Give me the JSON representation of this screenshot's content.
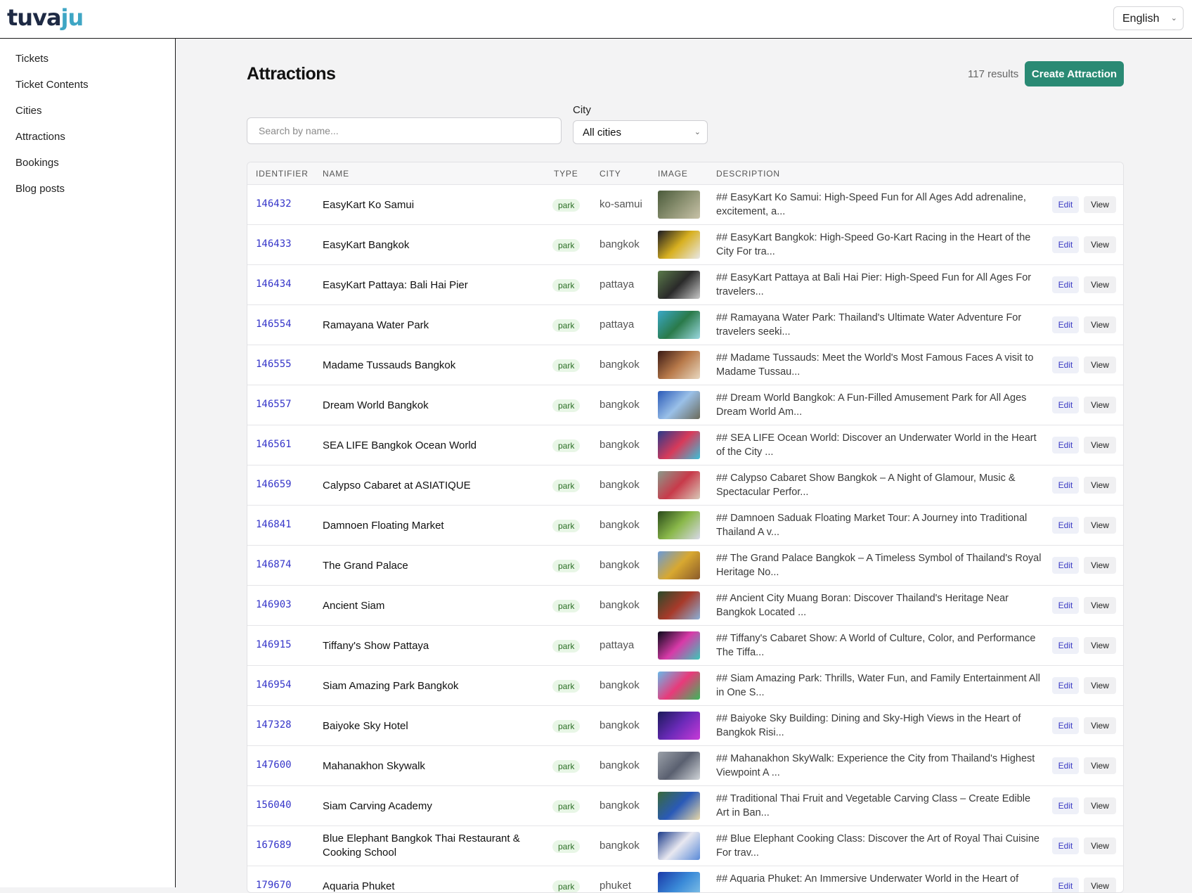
{
  "header": {
    "logo_main": "tuva",
    "logo_accent": "ju",
    "language": "English"
  },
  "sidebar": {
    "items": [
      {
        "label": "Tickets"
      },
      {
        "label": "Ticket Contents"
      },
      {
        "label": "Cities"
      },
      {
        "label": "Attractions"
      },
      {
        "label": "Bookings"
      },
      {
        "label": "Blog posts"
      }
    ]
  },
  "page": {
    "title": "Attractions",
    "results": "117 results",
    "create_label": "Create Attraction",
    "search_placeholder": "Search by name...",
    "city_label": "City",
    "city_value": "All cities"
  },
  "table": {
    "columns": [
      "IDENTIFIER",
      "NAME",
      "TYPE",
      "CITY",
      "IMAGE",
      "DESCRIPTION"
    ],
    "edit_label": "Edit",
    "view_label": "View",
    "rows": [
      {
        "id": "146432",
        "name": "EasyKart Ko Samui",
        "type": "park",
        "city": "ko-samui",
        "desc": "## EasyKart Ko Samui: High-Speed Fun for All Ages Add adrenaline, excitement, a...",
        "colors": [
          "#4a5a3a",
          "#8a9070",
          "#c8c2a8"
        ]
      },
      {
        "id": "146433",
        "name": "EasyKart Bangkok",
        "type": "park",
        "city": "bangkok",
        "desc": "## EasyKart Bangkok: High-Speed Go-Kart Racing in the Heart of the City For tra...",
        "colors": [
          "#1a1a22",
          "#d8b020",
          "#e8e8e8"
        ]
      },
      {
        "id": "146434",
        "name": "EasyKart Pattaya: Bali Hai Pier",
        "type": "park",
        "city": "pattaya",
        "desc": "## EasyKart Pattaya at Bali Hai Pier: High-Speed Fun for All Ages For travelers...",
        "colors": [
          "#5a7a4a",
          "#2a2a2a",
          "#c8c8c8"
        ]
      },
      {
        "id": "146554",
        "name": "Ramayana Water Park",
        "type": "park",
        "city": "pattaya",
        "desc": "## Ramayana Water Park: Thailand's Ultimate Water Adventure For travelers seeki...",
        "colors": [
          "#3aa8c8",
          "#2a7a4a",
          "#9ad8e0"
        ]
      },
      {
        "id": "146555",
        "name": "Madame Tussauds Bangkok",
        "type": "park",
        "city": "bangkok",
        "desc": "## Madame Tussauds: Meet the World's Most Famous Faces A visit to Madame Tussau...",
        "colors": [
          "#3a1a14",
          "#b87a4a",
          "#e8d8c0"
        ]
      },
      {
        "id": "146557",
        "name": "Dream World Bangkok",
        "type": "park",
        "city": "bangkok",
        "desc": "## Dream World Bangkok: A Fun-Filled Amusement Park for All Ages Dream World Am...",
        "colors": [
          "#2a5ab8",
          "#9ac0e8",
          "#6a6a5a"
        ]
      },
      {
        "id": "146561",
        "name": "SEA LIFE Bangkok Ocean World",
        "type": "park",
        "city": "bangkok",
        "desc": "## SEA LIFE Ocean World: Discover an Underwater World in the Heart of the City ...",
        "colors": [
          "#2a3a8a",
          "#d83a5a",
          "#3ac0d8"
        ]
      },
      {
        "id": "146659",
        "name": "Calypso Cabaret at ASIATIQUE",
        "type": "park",
        "city": "bangkok",
        "desc": "## Calypso Cabaret Show Bangkok – A Night of Glamour, Music & Spectacular Perfor...",
        "colors": [
          "#8a9a8a",
          "#c83a4a",
          "#d8c8b8"
        ]
      },
      {
        "id": "146841",
        "name": "Damnoen Floating Market",
        "type": "park",
        "city": "bangkok",
        "desc": "## Damnoen Saduak Floating Market Tour: A Journey into Traditional Thailand A v...",
        "colors": [
          "#2a4a1a",
          "#8ab84a",
          "#d8d8e8"
        ]
      },
      {
        "id": "146874",
        "name": "The Grand Palace",
        "type": "park",
        "city": "bangkok",
        "desc": "## The Grand Palace Bangkok – A Timeless Symbol of Thailand's Royal Heritage No...",
        "colors": [
          "#6a9ad8",
          "#d8a830",
          "#8a5a2a"
        ]
      },
      {
        "id": "146903",
        "name": "Ancient Siam",
        "type": "park",
        "city": "bangkok",
        "desc": "## Ancient City Muang Boran: Discover Thailand's Heritage Near Bangkok Located ...",
        "colors": [
          "#2a4a2a",
          "#a83a2a",
          "#8ab0d8"
        ]
      },
      {
        "id": "146915",
        "name": "Tiffany's Show Pattaya",
        "type": "park",
        "city": "pattaya",
        "desc": "## Tiffany's Cabaret Show: A World of Culture, Color, and Performance The Tiffa...",
        "colors": [
          "#0a0a1a",
          "#d83aa8",
          "#3ac8b8"
        ]
      },
      {
        "id": "146954",
        "name": "Siam Amazing Park Bangkok",
        "type": "park",
        "city": "bangkok",
        "desc": "## Siam Amazing Park: Thrills, Water Fun, and Family Entertainment All in One S...",
        "colors": [
          "#6ab8e8",
          "#e83a7a",
          "#3ab85a"
        ]
      },
      {
        "id": "147328",
        "name": "Baiyoke Sky Hotel",
        "type": "park",
        "city": "bangkok",
        "desc": "## Baiyoke Sky Building: Dining and Sky-High Views in the Heart of Bangkok Risi...",
        "colors": [
          "#1a1a5a",
          "#6a2ab8",
          "#c83ad8"
        ]
      },
      {
        "id": "147600",
        "name": "Mahanakhon Skywalk",
        "type": "park",
        "city": "bangkok",
        "desc": "## Mahanakhon SkyWalk: Experience the City from Thailand's Highest Viewpoint A ...",
        "colors": [
          "#9aa0a8",
          "#5a6070",
          "#d0d4d8"
        ]
      },
      {
        "id": "156040",
        "name": "Siam Carving Academy",
        "type": "park",
        "city": "bangkok",
        "desc": "## Traditional Thai Fruit and Vegetable Carving Class – Create Edible Art in Ban...",
        "colors": [
          "#3a6a3a",
          "#2a5ab8",
          "#e8d8a8"
        ]
      },
      {
        "id": "167689",
        "name": "Blue Elephant Bangkok Thai Restaurant & Cooking School",
        "type": "park",
        "city": "bangkok",
        "desc": "## Blue Elephant Cooking Class: Discover the Art of Royal Thai Cuisine For trav...",
        "colors": [
          "#1a3a8a",
          "#e8e8f0",
          "#5a8ad8"
        ]
      },
      {
        "id": "179670",
        "name": "Aquaria Phuket",
        "type": "park",
        "city": "phuket",
        "desc": "## Aquaria Phuket: An Immersive Underwater World in the Heart of",
        "colors": [
          "#1a3aa8",
          "#3a8ad8",
          "#8ac8e8"
        ]
      }
    ]
  }
}
